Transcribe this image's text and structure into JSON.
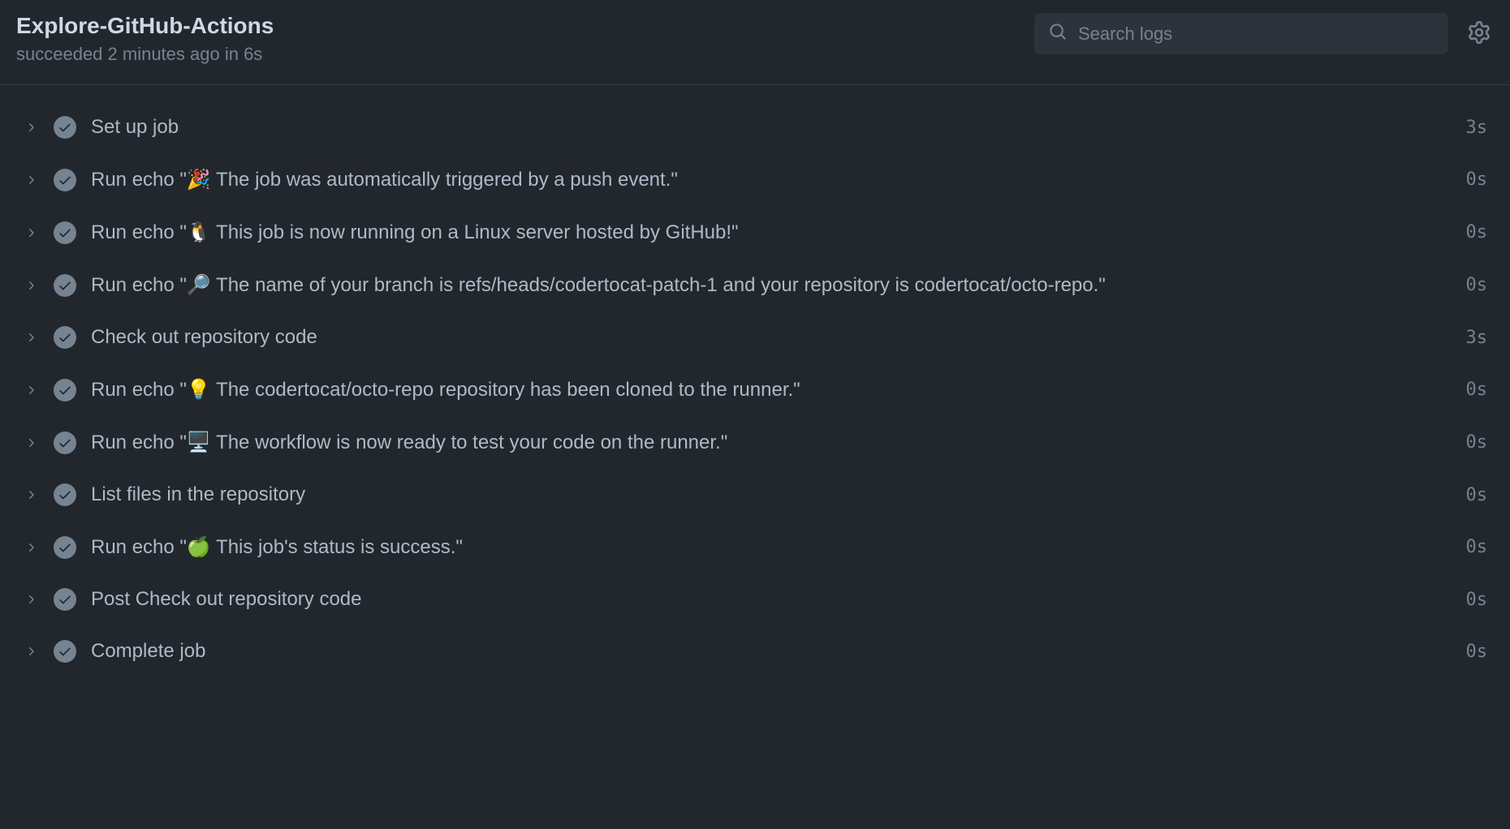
{
  "header": {
    "title": "Explore-GitHub-Actions",
    "subtitle": "succeeded 2 minutes ago in 6s"
  },
  "search": {
    "placeholder": "Search logs"
  },
  "steps": [
    {
      "label": "Set up job",
      "duration": "3s"
    },
    {
      "label": "Run echo \"🎉 The job was automatically triggered by a push event.\"",
      "duration": "0s"
    },
    {
      "label": "Run echo \"🐧 This job is now running on a Linux server hosted by GitHub!\"",
      "duration": "0s"
    },
    {
      "label": "Run echo \"🔎 The name of your branch is refs/heads/codertocat-patch-1 and your repository is codertocat/octo-repo.\"",
      "duration": "0s"
    },
    {
      "label": "Check out repository code",
      "duration": "3s"
    },
    {
      "label": "Run echo \"💡 The codertocat/octo-repo repository has been cloned to the runner.\"",
      "duration": "0s"
    },
    {
      "label": "Run echo \"🖥️ The workflow is now ready to test your code on the runner.\"",
      "duration": "0s"
    },
    {
      "label": "List files in the repository",
      "duration": "0s"
    },
    {
      "label": "Run echo \"🍏 This job's status is success.\"",
      "duration": "0s"
    },
    {
      "label": "Post Check out repository code",
      "duration": "0s"
    },
    {
      "label": "Complete job",
      "duration": "0s"
    }
  ]
}
